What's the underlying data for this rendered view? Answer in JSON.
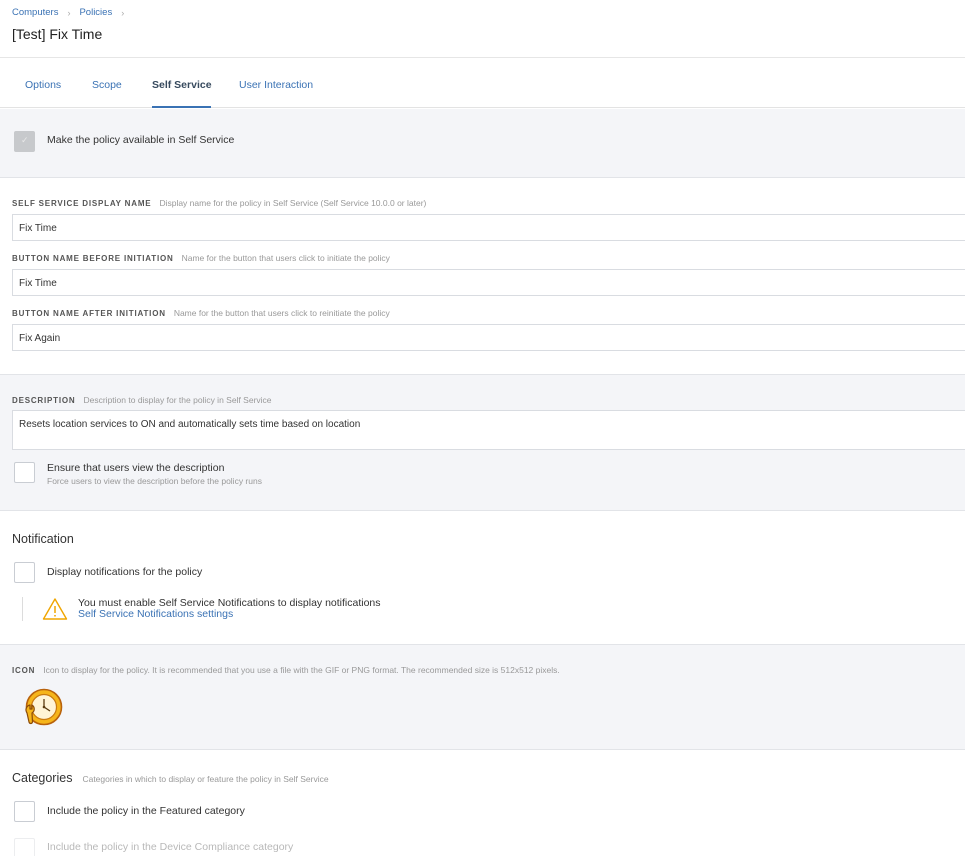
{
  "breadcrumb": {
    "items": [
      "Computers",
      "Policies"
    ],
    "separator": "›"
  },
  "title": "[Test] Fix Time",
  "tabs": [
    {
      "label": "Options"
    },
    {
      "label": "Scope"
    },
    {
      "label": "Self Service"
    },
    {
      "label": "User Interaction"
    }
  ],
  "active_tab": "Self Service",
  "availability": {
    "label": "Make the policy available in Self Service",
    "checked": true
  },
  "display_name": {
    "label": "SELF SERVICE DISPLAY NAME",
    "hint": "Display name for the policy in Self Service (Self Service 10.0.0 or later)",
    "value": "Fix Time"
  },
  "button_before": {
    "label": "BUTTON NAME BEFORE INITIATION",
    "hint": "Name for the button that users click to initiate the policy",
    "value": "Fix Time"
  },
  "button_after": {
    "label": "BUTTON NAME AFTER INITIATION",
    "hint": "Name for the button that users click to reinitiate the policy",
    "value": "Fix Again"
  },
  "description": {
    "label": "DESCRIPTION",
    "hint": "Description to display for the policy in Self Service",
    "value": "Resets location services to ON and automatically sets time based on location"
  },
  "ensure_view": {
    "label": "Ensure that users view the description",
    "sub": "Force users to view the description before the policy runs",
    "checked": false
  },
  "notification": {
    "heading": "Notification",
    "checkbox_label": "Display notifications for the policy",
    "checked": false,
    "warning": "You must enable Self Service Notifications to display notifications",
    "link": "Self Service Notifications settings"
  },
  "icon_section": {
    "label": "ICON",
    "hint": "Icon to display for the policy. It is recommended that you use a file with the GIF or PNG format. The recommended size is 512x512 pixels.",
    "icon": "clock-wrench-icon"
  },
  "categories": {
    "heading": "Categories",
    "hint": "Categories in which to display or feature the policy in Self Service",
    "featured_label": "Include the policy in the Featured category",
    "compliance_label": "Include the policy in the Device Compliance category"
  },
  "colors": {
    "link": "#3a72b4",
    "warning": "#f0a500",
    "section_bg": "#f4f5f8"
  }
}
